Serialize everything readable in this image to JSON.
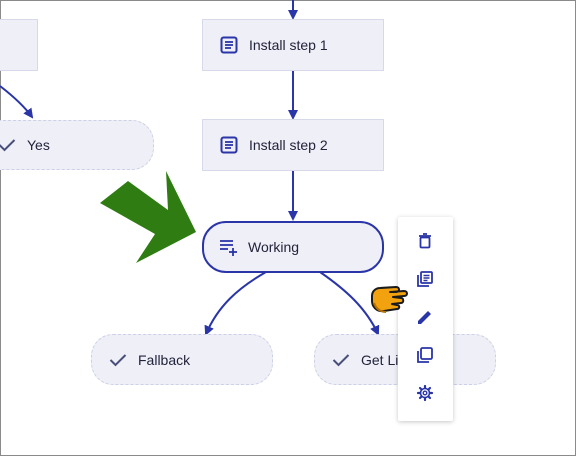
{
  "nodes": {
    "install_step_1": "Install step 1",
    "install_step_2": "Install step 2",
    "working": "Working",
    "yes": "Yes",
    "fallback": "Fallback",
    "get_li": "Get Li"
  },
  "toolbar": {
    "actions": [
      "delete",
      "duplicate",
      "edit",
      "copy",
      "settings"
    ]
  },
  "colors": {
    "accent": "#2a35a8",
    "node_bg": "#eeeff7",
    "node_border": "#d7d9ea",
    "arrow_green": "#2f7d12",
    "pointer_hand": "#f2a20f"
  },
  "icons": {
    "step": "list-box-icon",
    "working": "playlist-add-icon",
    "branch": "check-icon",
    "pointer": "pointing-hand-icon",
    "indicator": "big-green-arrow-icon"
  }
}
